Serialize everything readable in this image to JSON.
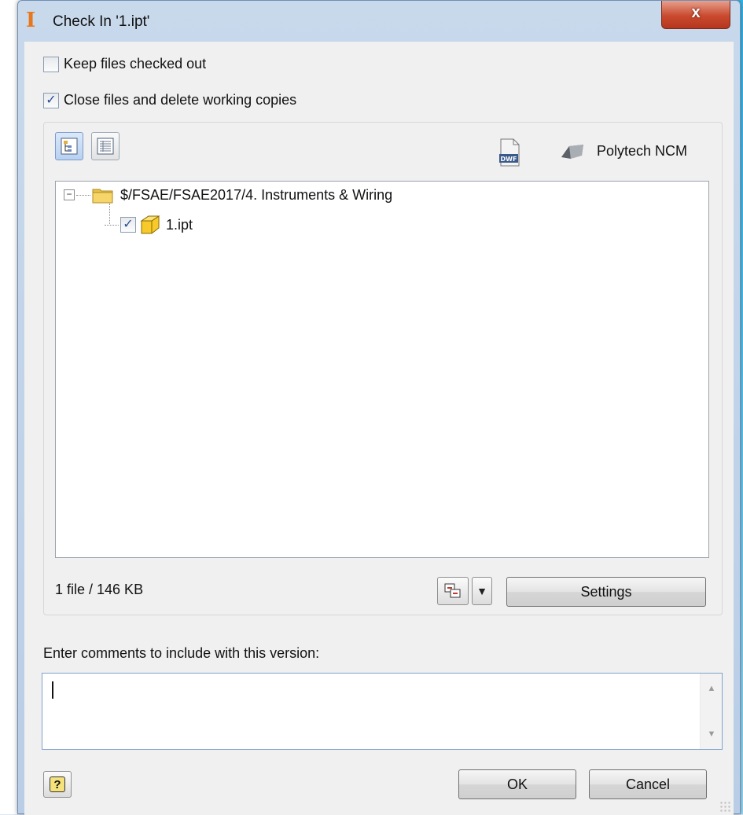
{
  "window": {
    "title": "Check In '1.ipt'",
    "close_label": "x"
  },
  "options": {
    "keep_checked_out": {
      "label": "Keep files checked out",
      "checked": false
    },
    "close_and_delete": {
      "label": "Close files and delete working copies",
      "checked": true
    }
  },
  "toolbar": {
    "tree_view_icon": "tree-view-icon",
    "list_view_icon": "list-view-icon",
    "dwf_icon": "dwf-icon",
    "vault_icon": "vault-server-icon",
    "vault_name": "Polytech NCM"
  },
  "tree": {
    "folder": {
      "path": "$/FSAE/FSAE2017/4. Instruments & Wiring",
      "expanded": true
    },
    "files": [
      {
        "name": "1.ipt",
        "checked": true
      }
    ]
  },
  "summary": "1 file / 146 KB",
  "settings_label": "Settings",
  "comment": {
    "label": "Enter comments to include with this version:",
    "value": ""
  },
  "buttons": {
    "ok": "OK",
    "cancel": "Cancel",
    "help": "?"
  },
  "colors": {
    "title_bar": "#c9d9ec",
    "close_button": "#c94a2e",
    "accent": "#2a4d8f"
  }
}
